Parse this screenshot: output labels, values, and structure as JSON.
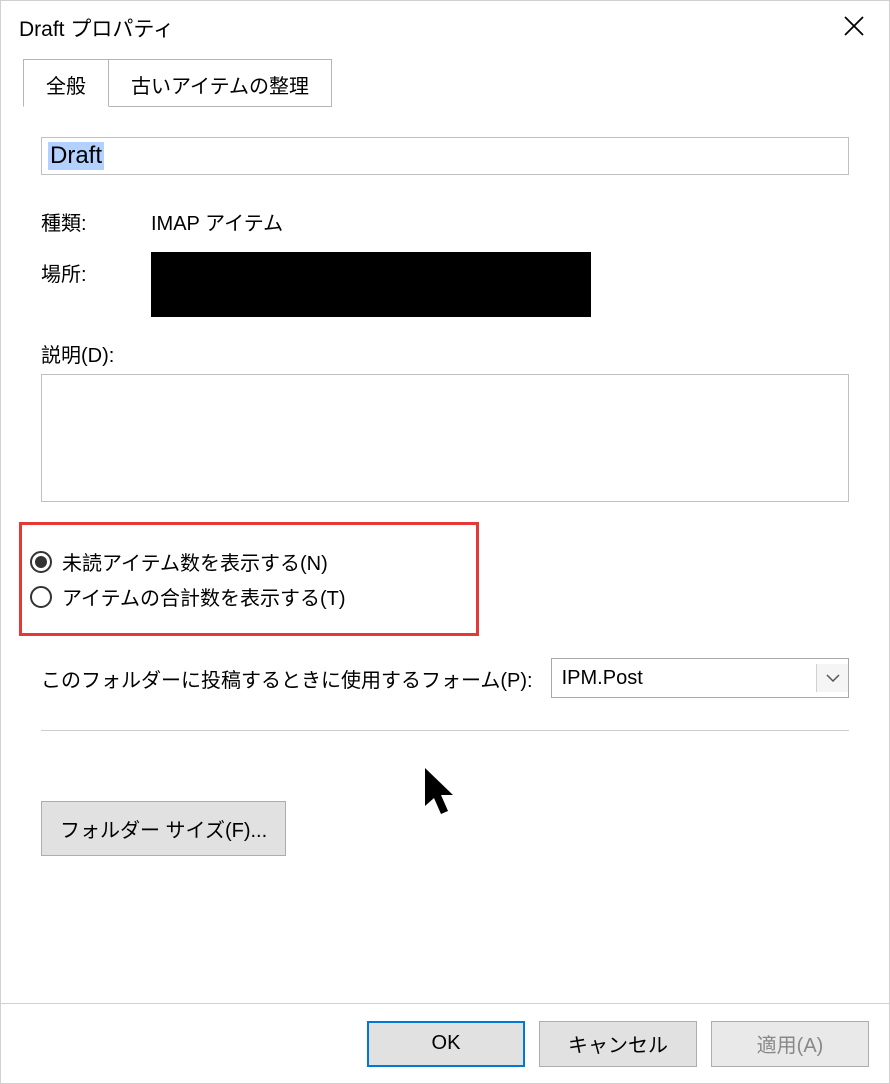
{
  "window": {
    "title": "Draft プロパティ"
  },
  "tabs": {
    "general": "全般",
    "archive": "古いアイテムの整理"
  },
  "folder": {
    "name": "Draft",
    "type_label": "種類:",
    "type_value": "IMAP アイテム",
    "location_label": "場所:",
    "description_label": "説明(D):",
    "description_value": ""
  },
  "radios": {
    "unread_label": "未読アイテム数を表示する(N)",
    "total_label": "アイテムの合計数を表示する(T)",
    "selected": "unread"
  },
  "form": {
    "label": "このフォルダーに投稿するときに使用するフォーム(P):",
    "selected_value": "IPM.Post"
  },
  "buttons": {
    "folder_size": "フォルダー サイズ(F)...",
    "ok": "OK",
    "cancel": "キャンセル",
    "apply": "適用(A)"
  }
}
